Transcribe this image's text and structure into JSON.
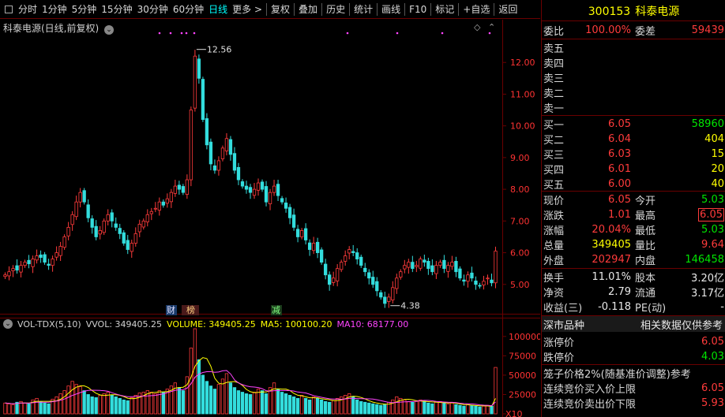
{
  "toolbar": {
    "items": [
      "分时",
      "1分钟",
      "5分钟",
      "15分钟",
      "30分钟",
      "60分钟",
      "日线",
      "更多 >"
    ],
    "active": "日线",
    "actions": [
      "复权",
      "叠加",
      "历史",
      "统计",
      "画线",
      "F10",
      "标记",
      "+自选",
      "返回"
    ]
  },
  "chart": {
    "title": "科泰电源(日线,前复权)",
    "marker_high": "12.56",
    "marker_low": "4.38",
    "events": {
      "cai": "财",
      "bang": "榜",
      "jian": "减"
    },
    "price_ticks": [
      "12.00",
      "11.00",
      "10.00",
      "9.00",
      "8.00",
      "7.00",
      "6.00",
      "5.00"
    ],
    "vol_ticks": [
      "100000",
      "75000",
      "50000",
      "25000",
      "X10"
    ],
    "volume_header": {
      "name": "VOL-TDX(5,10)",
      "vvol": "VVOL: 349405.25",
      "volume": "VOLUME: 349405.25",
      "ma5": "MA5: 100100.20",
      "ma10": "MA10: 68177.00"
    }
  },
  "chart_data": {
    "type": "candlestick",
    "title": "科泰电源(日线,前复权)",
    "price_range": [
      4.1,
      13.0
    ],
    "volume_range": [
      0,
      110000
    ],
    "high": 12.56,
    "low": 4.38,
    "closes": [
      5.3,
      5.4,
      5.5,
      5.45,
      5.6,
      5.7,
      5.65,
      5.8,
      5.9,
      5.85,
      5.7,
      5.6,
      5.8,
      6.0,
      6.2,
      6.5,
      6.8,
      7.2,
      7.6,
      7.9,
      7.6,
      7.1,
      6.8,
      6.5,
      6.7,
      7.0,
      7.2,
      7.0,
      6.8,
      6.6,
      6.3,
      6.1,
      6.3,
      6.6,
      6.9,
      7.0,
      7.2,
      7.3,
      7.4,
      7.6,
      7.5,
      7.7,
      7.9,
      8.1,
      8.0,
      7.9,
      8.3,
      10.5,
      12.2,
      11.5,
      10.2,
      9.4,
      8.8,
      8.6,
      8.9,
      9.3,
      9.6,
      9.1,
      8.6,
      8.3,
      8.1,
      8.0,
      7.9,
      8.0,
      8.2,
      8.0,
      7.6,
      7.9,
      8.1,
      7.8,
      7.6,
      7.4,
      7.1,
      6.8,
      6.5,
      6.7,
      6.4,
      6.1,
      6.3,
      6.0,
      5.7,
      5.3,
      5.0,
      5.2,
      5.5,
      5.7,
      5.9,
      6.1,
      6.0,
      5.8,
      5.6,
      5.4,
      5.2,
      5.0,
      4.8,
      4.6,
      4.4,
      4.6,
      4.9,
      5.2,
      5.4,
      5.6,
      5.7,
      5.5,
      5.6,
      5.8,
      5.7,
      5.5,
      5.4,
      5.6,
      5.7,
      5.5,
      5.6,
      5.7,
      5.4,
      5.2,
      5.1,
      5.3,
      5.2,
      5.0,
      4.95,
      5.1,
      5.2,
      5.05,
      6.05
    ],
    "volumes": [
      14000,
      13000,
      12000,
      15000,
      16000,
      14000,
      13000,
      18000,
      20000,
      16000,
      14000,
      13000,
      19000,
      22000,
      26000,
      30000,
      36000,
      42000,
      38000,
      35000,
      30000,
      25000,
      22000,
      21000,
      24000,
      26000,
      28000,
      24000,
      22000,
      20000,
      18000,
      17000,
      21000,
      24000,
      27000,
      28000,
      30000,
      28000,
      26000,
      30000,
      28000,
      32000,
      36000,
      40000,
      34000,
      30000,
      48000,
      85000,
      110000,
      70000,
      50000,
      42000,
      36000,
      32000,
      38000,
      45000,
      52000,
      40000,
      34000,
      30000,
      28000,
      26000,
      25000,
      28000,
      32000,
      30000,
      26000,
      34000,
      40000,
      32000,
      28000,
      26000,
      24000,
      22000,
      20000,
      24000,
      20000,
      18000,
      22000,
      20000,
      18000,
      16000,
      15000,
      17000,
      20000,
      22000,
      24000,
      26000,
      22000,
      18000,
      16000,
      15000,
      14000,
      13000,
      12000,
      11000,
      12000,
      15000,
      18000,
      22000,
      20000,
      18000,
      16000,
      15000,
      16000,
      18000,
      16000,
      14000,
      13000,
      15000,
      16000,
      14000,
      13000,
      14000,
      12000,
      11000,
      10000,
      12000,
      11000,
      10000,
      9000,
      10000,
      11000,
      10000,
      60000
    ]
  },
  "quote": {
    "code": "300153",
    "name": "科泰电源",
    "weibi_label": "委比",
    "weibi_value": "100.00%",
    "weicha_label": "委差",
    "weicha_value": "59439",
    "sell": [
      {
        "label": "卖五",
        "price": "",
        "vol": ""
      },
      {
        "label": "卖四",
        "price": "",
        "vol": ""
      },
      {
        "label": "卖三",
        "price": "",
        "vol": ""
      },
      {
        "label": "卖二",
        "price": "",
        "vol": ""
      },
      {
        "label": "卖一",
        "price": "",
        "vol": ""
      }
    ],
    "buy": [
      {
        "label": "买一",
        "price": "6.05",
        "vol": "58960"
      },
      {
        "label": "买二",
        "price": "6.04",
        "vol": "404"
      },
      {
        "label": "买三",
        "price": "6.03",
        "vol": "15"
      },
      {
        "label": "买四",
        "price": "6.01",
        "vol": "20"
      },
      {
        "label": "买五",
        "price": "6.00",
        "vol": "40"
      }
    ],
    "stats": [
      {
        "l1": "现价",
        "v1": "6.05",
        "c1": "red",
        "l2": "今开",
        "v2": "5.03",
        "c2": "green"
      },
      {
        "l1": "涨跌",
        "v1": "1.01",
        "c1": "red",
        "l2": "最高",
        "v2": "6.05",
        "c2": "red"
      },
      {
        "l1": "涨幅",
        "v1": "20.04%",
        "c1": "red",
        "l2": "最低",
        "v2": "5.03",
        "c2": "green"
      },
      {
        "l1": "总量",
        "v1": "349405",
        "c1": "yellow",
        "l2": "量比",
        "v2": "9.64",
        "c2": "red"
      },
      {
        "l1": "外盘",
        "v1": "202947",
        "c1": "red",
        "l2": "内盘",
        "v2": "146458",
        "c2": "green"
      }
    ],
    "finance": [
      {
        "l1": "换手",
        "v1": "11.01%",
        "l2": "股本",
        "v2": "3.20亿"
      },
      {
        "l1": "净资",
        "v1": "2.79",
        "l2": "流通",
        "v2": "3.17亿"
      },
      {
        "l1": "收益(三)",
        "v1": "-0.118",
        "l2": "PE(动)",
        "v2": "-"
      }
    ],
    "section_tab1": "深市品种",
    "section_tab2": "相关数据仅供参考",
    "limit_up_label": "涨停价",
    "limit_up_value": "6.05",
    "limit_down_label": "跌停价",
    "limit_down_value": "4.03",
    "cage_label": "笼子价格2%(随基准价调整)参考",
    "cont_buy_label": "连续竞价买入价上限",
    "cont_buy_value": "6.05",
    "cont_sell_label": "连续竞价卖出价下限",
    "cont_sell_value": "5.93"
  },
  "colors": {
    "up": "#ff3b3b",
    "down": "#33dddd",
    "ma5": "#ffff00",
    "ma10": "#ff44ff",
    "grid": "#6a0000"
  }
}
